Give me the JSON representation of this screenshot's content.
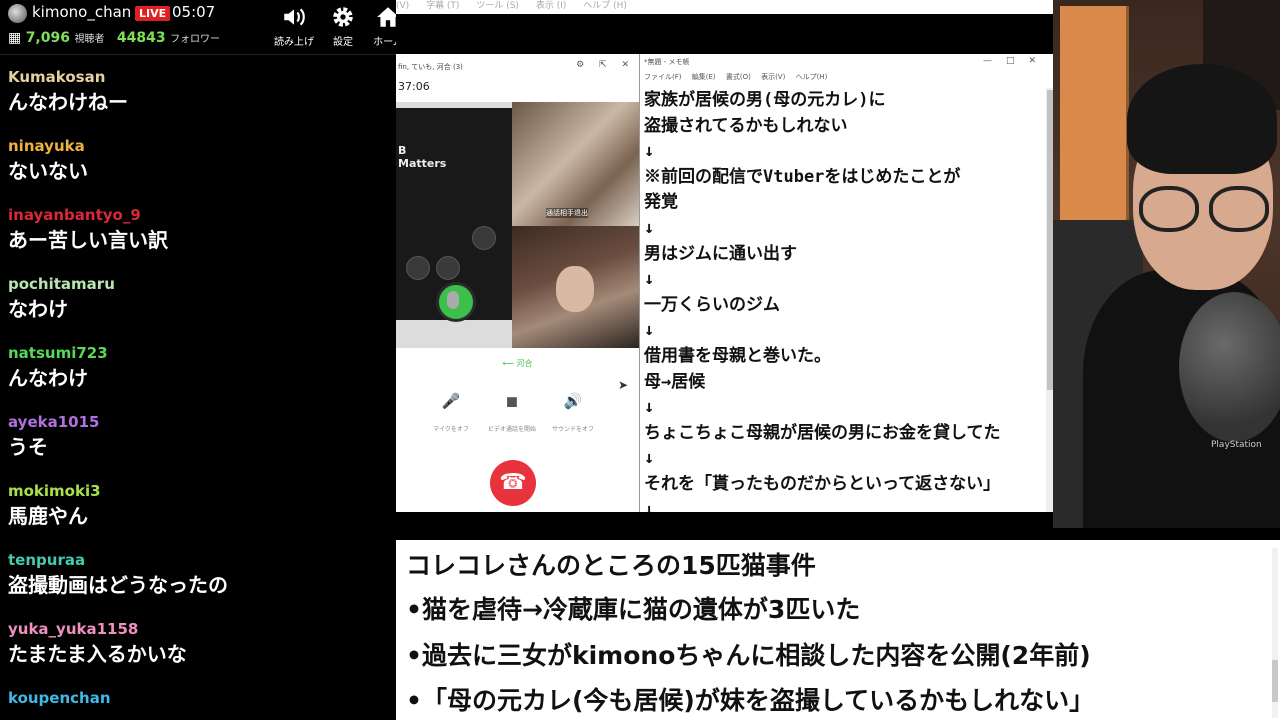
{
  "stream": {
    "streamer": "kimono_chan",
    "live_badge": "LIVE",
    "elapsed": "05:07",
    "viewers": "7,096",
    "viewers_label": "視聴者",
    "followers": "44843",
    "followers_label": "フォロワー"
  },
  "toolbar": [
    {
      "label": "読み上げ",
      "icon": "speaker-icon"
    },
    {
      "label": "設定",
      "icon": "gear-icon"
    },
    {
      "label": "ホーム",
      "icon": "home-icon"
    }
  ],
  "chat": [
    {
      "user": "Kumakosan",
      "color": "#e6d2a0",
      "text": "んなわけねー"
    },
    {
      "user": "ninayuka",
      "color": "#f0b040",
      "text": "ないない"
    },
    {
      "user": "inayanbantyo_9",
      "color": "#d8283a",
      "text": "あー苦しい言い訳"
    },
    {
      "user": "pochitamaru",
      "color": "#b8e6b0",
      "text": "なわけ"
    },
    {
      "user": "natsumi723",
      "color": "#58d858",
      "text": "んなわけ"
    },
    {
      "user": "ayeka1015",
      "color": "#b070e0",
      "text": "うそ"
    },
    {
      "user": "mokimoki3",
      "color": "#a8e048",
      "text": "馬鹿やん"
    },
    {
      "user": "tenpuraa",
      "color": "#48c8b0",
      "text": "盗撮動画はどうなったの"
    },
    {
      "user": "yuka_yuka1158",
      "color": "#f090c0",
      "text": "たまたま入るかいな"
    },
    {
      "user": "koupenchan",
      "color": "#40b8e8",
      "text": ""
    }
  ],
  "desktop_menu": [
    "(V)",
    "字幕 (T)",
    "ツール (S)",
    "表示 (I)",
    "ヘルプ (H)"
  ],
  "call": {
    "title": "fin, ていも, 河合 (3)",
    "elapsed": "37:06",
    "equipment_text": "B\nMatters",
    "video_caption": "通話相手退出",
    "participant_label": "河合",
    "controls": [
      {
        "label": "マイクをオフ",
        "icon": "microphone-icon"
      },
      {
        "label": "ビデオ通話を開始",
        "icon": "video-camera-icon"
      },
      {
        "label": "サウンドをオフ",
        "icon": "speaker-icon"
      }
    ]
  },
  "notepad": {
    "title": "*無題 - メモ帳",
    "menu": [
      "ファイル(F)",
      "編集(E)",
      "書式(O)",
      "表示(V)",
      "ヘルプ(H)"
    ],
    "lines": [
      "家族が居候の男(母の元カレ)に",
      "盗撮されてるかもしれない",
      "↓",
      "※前回の配信でVtuberをはじめたことが",
      "発覚",
      "↓",
      "男はジムに通い出す",
      "↓",
      "一万くらいのジム",
      "↓",
      "借用書を母親と巻いた。",
      "母→居候",
      "↓",
      "ちょこちょこ母親が居候の男にお金を貸してた",
      "↓",
      "それを「貰ったものだからといって返さない」",
      "↓"
    ]
  },
  "webcam": {
    "logo": "PlayStation"
  },
  "caption": [
    "コレコレさんのところの15匹猫事件",
    "•猫を虐待→冷蔵庫に猫の遺体が3匹いた",
    "•過去に三女がkimonoちゃんに相談した内容を公開(2年前)",
    "•「母の元カレ(今も居候)が妹を盗撮しているかもしれない」"
  ]
}
